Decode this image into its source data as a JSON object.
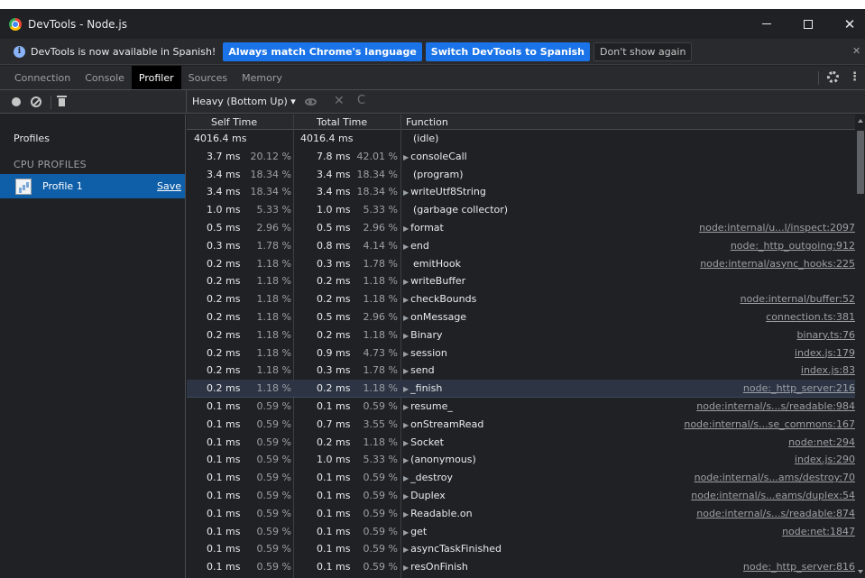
{
  "window": {
    "title": "DevTools - Node.js",
    "minimize_glyph": "",
    "close_glyph": "✕"
  },
  "infobar": {
    "message": "DevTools is now available in Spanish!",
    "buttons": [
      "Always match Chrome's language",
      "Switch DevTools to Spanish",
      "Don't show again"
    ],
    "close_glyph": "✕"
  },
  "tabs": [
    "Connection",
    "Console",
    "Profiler",
    "Sources",
    "Memory"
  ],
  "active_tab": "Profiler",
  "toolbar": {
    "view_mode": "Heavy (Bottom Up) ▾",
    "close_glyph": "✕",
    "reload_glyph": "C"
  },
  "sidebar": {
    "title": "Profiles",
    "section": "CPU PROFILES",
    "profile_name": "Profile 1",
    "save_label": "Save"
  },
  "table": {
    "headers": {
      "self": "Self Time",
      "total": "Total Time",
      "function": "Function"
    },
    "idle_row": {
      "self": "4016.4 ms",
      "total": "4016.4 ms",
      "function": "(idle)"
    },
    "rows": [
      {
        "self_ms": "3.7 ms",
        "self_pct": "20.12 %",
        "total_ms": "7.8 ms",
        "total_pct": "42.01 %",
        "function": "consoleCall",
        "expandable": true,
        "link": ""
      },
      {
        "self_ms": "3.4 ms",
        "self_pct": "18.34 %",
        "total_ms": "3.4 ms",
        "total_pct": "18.34 %",
        "function": "(program)",
        "expandable": false,
        "link": ""
      },
      {
        "self_ms": "3.4 ms",
        "self_pct": "18.34 %",
        "total_ms": "3.4 ms",
        "total_pct": "18.34 %",
        "function": "writeUtf8String",
        "expandable": true,
        "link": ""
      },
      {
        "self_ms": "1.0 ms",
        "self_pct": "5.33 %",
        "total_ms": "1.0 ms",
        "total_pct": "5.33 %",
        "function": "(garbage collector)",
        "expandable": false,
        "link": ""
      },
      {
        "self_ms": "0.5 ms",
        "self_pct": "2.96 %",
        "total_ms": "0.5 ms",
        "total_pct": "2.96 %",
        "function": "format",
        "expandable": true,
        "link": "node:internal/u...l/inspect:2097"
      },
      {
        "self_ms": "0.3 ms",
        "self_pct": "1.78 %",
        "total_ms": "0.8 ms",
        "total_pct": "4.14 %",
        "function": "end",
        "expandable": true,
        "link": "node:_http_outgoing:912"
      },
      {
        "self_ms": "0.2 ms",
        "self_pct": "1.18 %",
        "total_ms": "0.3 ms",
        "total_pct": "1.78 %",
        "function": "emitHook",
        "expandable": false,
        "link": "node:internal/async_hooks:225"
      },
      {
        "self_ms": "0.2 ms",
        "self_pct": "1.18 %",
        "total_ms": "0.2 ms",
        "total_pct": "1.18 %",
        "function": "writeBuffer",
        "expandable": true,
        "link": ""
      },
      {
        "self_ms": "0.2 ms",
        "self_pct": "1.18 %",
        "total_ms": "0.2 ms",
        "total_pct": "1.18 %",
        "function": "checkBounds",
        "expandable": true,
        "link": "node:internal/buffer:52"
      },
      {
        "self_ms": "0.2 ms",
        "self_pct": "1.18 %",
        "total_ms": "0.5 ms",
        "total_pct": "2.96 %",
        "function": "onMessage",
        "expandable": true,
        "link": "connection.ts:381"
      },
      {
        "self_ms": "0.2 ms",
        "self_pct": "1.18 %",
        "total_ms": "0.2 ms",
        "total_pct": "1.18 %",
        "function": "Binary",
        "expandable": true,
        "link": "binary.ts:76"
      },
      {
        "self_ms": "0.2 ms",
        "self_pct": "1.18 %",
        "total_ms": "0.9 ms",
        "total_pct": "4.73 %",
        "function": "session",
        "expandable": true,
        "link": "index.js:179"
      },
      {
        "self_ms": "0.2 ms",
        "self_pct": "1.18 %",
        "total_ms": "0.3 ms",
        "total_pct": "1.78 %",
        "function": "send",
        "expandable": true,
        "link": "index.js:83"
      },
      {
        "self_ms": "0.2 ms",
        "self_pct": "1.18 %",
        "total_ms": "0.2 ms",
        "total_pct": "1.18 %",
        "function": "_finish",
        "expandable": true,
        "link": "node:_http_server:216",
        "selected": true
      },
      {
        "self_ms": "0.1 ms",
        "self_pct": "0.59 %",
        "total_ms": "0.1 ms",
        "total_pct": "0.59 %",
        "function": "resume_",
        "expandable": true,
        "link": "node:internal/s...s/readable:984"
      },
      {
        "self_ms": "0.1 ms",
        "self_pct": "0.59 %",
        "total_ms": "0.7 ms",
        "total_pct": "3.55 %",
        "function": "onStreamRead",
        "expandable": true,
        "link": "node:internal/s...se_commons:167"
      },
      {
        "self_ms": "0.1 ms",
        "self_pct": "0.59 %",
        "total_ms": "0.2 ms",
        "total_pct": "1.18 %",
        "function": "Socket",
        "expandable": true,
        "link": "node:net:294"
      },
      {
        "self_ms": "0.1 ms",
        "self_pct": "0.59 %",
        "total_ms": "1.0 ms",
        "total_pct": "5.33 %",
        "function": "(anonymous)",
        "expandable": true,
        "link": "index.js:290"
      },
      {
        "self_ms": "0.1 ms",
        "self_pct": "0.59 %",
        "total_ms": "0.1 ms",
        "total_pct": "0.59 %",
        "function": "_destroy",
        "expandable": true,
        "link": "node:internal/s...ams/destroy:70"
      },
      {
        "self_ms": "0.1 ms",
        "self_pct": "0.59 %",
        "total_ms": "0.1 ms",
        "total_pct": "0.59 %",
        "function": "Duplex",
        "expandable": true,
        "link": "node:internal/s...eams/duplex:54"
      },
      {
        "self_ms": "0.1 ms",
        "self_pct": "0.59 %",
        "total_ms": "0.1 ms",
        "total_pct": "0.59 %",
        "function": "Readable.on",
        "expandable": true,
        "link": "node:internal/s...s/readable:874"
      },
      {
        "self_ms": "0.1 ms",
        "self_pct": "0.59 %",
        "total_ms": "0.1 ms",
        "total_pct": "0.59 %",
        "function": "get",
        "expandable": true,
        "link": "node:net:1847"
      },
      {
        "self_ms": "0.1 ms",
        "self_pct": "0.59 %",
        "total_ms": "0.1 ms",
        "total_pct": "0.59 %",
        "function": "asyncTaskFinished",
        "expandable": true,
        "link": ""
      },
      {
        "self_ms": "0.1 ms",
        "self_pct": "0.59 %",
        "total_ms": "0.1 ms",
        "total_pct": "0.59 %",
        "function": "resOnFinish",
        "expandable": true,
        "link": "node:_http_server:816"
      }
    ]
  },
  "icons": {
    "window": "chrome-logo-icon",
    "info": "info-icon",
    "record": "record-icon",
    "clear": "clear-icon",
    "trash": "trash-icon",
    "focus": "eye-icon",
    "exclude": "close-icon",
    "restore": "reload-icon",
    "settings": "gear-icon",
    "more": "kebab-menu-icon",
    "expand": "triangle-right-icon"
  },
  "colors": {
    "background": "#202124",
    "panel": "#292a2d",
    "accent_button": "#1a73e8",
    "selected_profile": "#0f5ea8",
    "selected_row": "#2d3443"
  }
}
